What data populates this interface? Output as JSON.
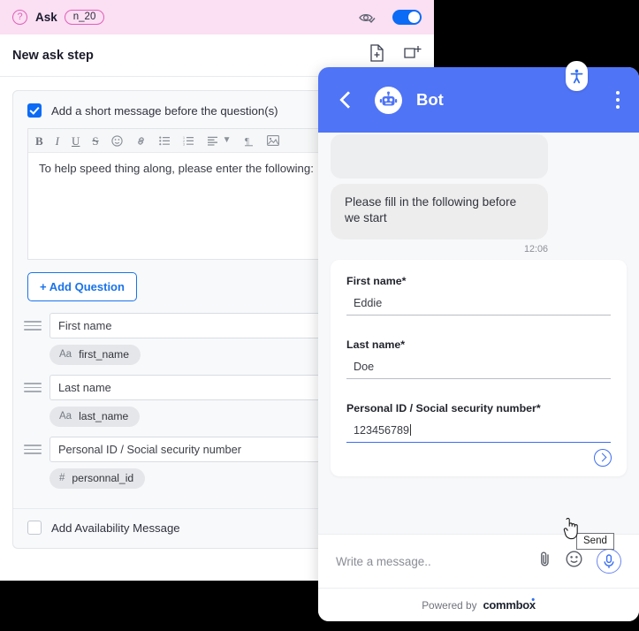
{
  "editor": {
    "ask_header": {
      "help_icon": "question-circle-icon",
      "label": "Ask",
      "node_tag": "n_20",
      "preview_icon": "eye-check-icon",
      "toggle_state": "on"
    },
    "step": {
      "title": "New ask step",
      "icons": [
        "document-add-icon",
        "panel-add-icon"
      ]
    },
    "message_section": {
      "checkbox_checked": true,
      "checkbox_label": "Add a short message before the question(s)",
      "toolbar": [
        {
          "name": "bold-icon",
          "glyph": "B"
        },
        {
          "name": "italic-icon",
          "glyph": "I"
        },
        {
          "name": "underline-icon",
          "glyph": "U"
        },
        {
          "name": "strikethrough-icon",
          "glyph": "S"
        },
        {
          "name": "emoji-icon",
          "glyph": "☺"
        },
        {
          "name": "link-icon",
          "glyph": "🔗"
        },
        {
          "name": "bullet-list-icon",
          "glyph": "☰"
        },
        {
          "name": "numbered-list-icon",
          "glyph": "☰"
        },
        {
          "name": "align-icon",
          "glyph": "≡"
        },
        {
          "name": "chevron-down-icon",
          "glyph": "⌄"
        },
        {
          "name": "paragraph-icon",
          "glyph": "¶"
        },
        {
          "name": "image-icon",
          "glyph": "▣"
        }
      ],
      "body_text": "To help speed thing along, please enter the following:"
    },
    "add_question_label": "+ Add Question",
    "questions": [
      {
        "label": "First name",
        "type_icon": "Aa",
        "variable": "first_name"
      },
      {
        "label": "Last name",
        "type_icon": "Aa",
        "variable": "last_name"
      },
      {
        "label": "Personal ID / Social security number",
        "type_icon": "#",
        "variable": "personnal_id"
      }
    ],
    "availability": {
      "checkbox_checked": false,
      "label": "Add Availability Message"
    }
  },
  "chat": {
    "header": {
      "back_icon": "back-chevron-icon",
      "avatar_icon": "robot-avatar-icon",
      "title": "Bot",
      "accessibility_icon": "accessibility-icon",
      "menu_icon": "kebab-menu-icon"
    },
    "messages": [
      {
        "text": "Please fill in the following before we start",
        "time": "12:06"
      }
    ],
    "form": {
      "fields": [
        {
          "label": "First name*",
          "value": "Eddie",
          "active": false
        },
        {
          "label": "Last name*",
          "value": "Doe",
          "active": false
        },
        {
          "label": "Personal ID / Social security number*",
          "value": "123456789",
          "active": true
        }
      ],
      "submit_icon": "send-arrow-icon"
    },
    "input_bar": {
      "placeholder": "Write a message..",
      "icons": [
        "attachment-icon",
        "emoji-icon",
        "microphone-icon"
      ]
    },
    "footer": {
      "powered_by": "Powered by",
      "brand": "commbox"
    },
    "tooltip": "Send"
  },
  "colors": {
    "ask_header_bg": "#fbdff2",
    "accent_pink": "#e05fbb",
    "accent_blue": "#0b6bf5",
    "chat_blue": "#4f74f6",
    "link_blue": "#1a73e8"
  }
}
